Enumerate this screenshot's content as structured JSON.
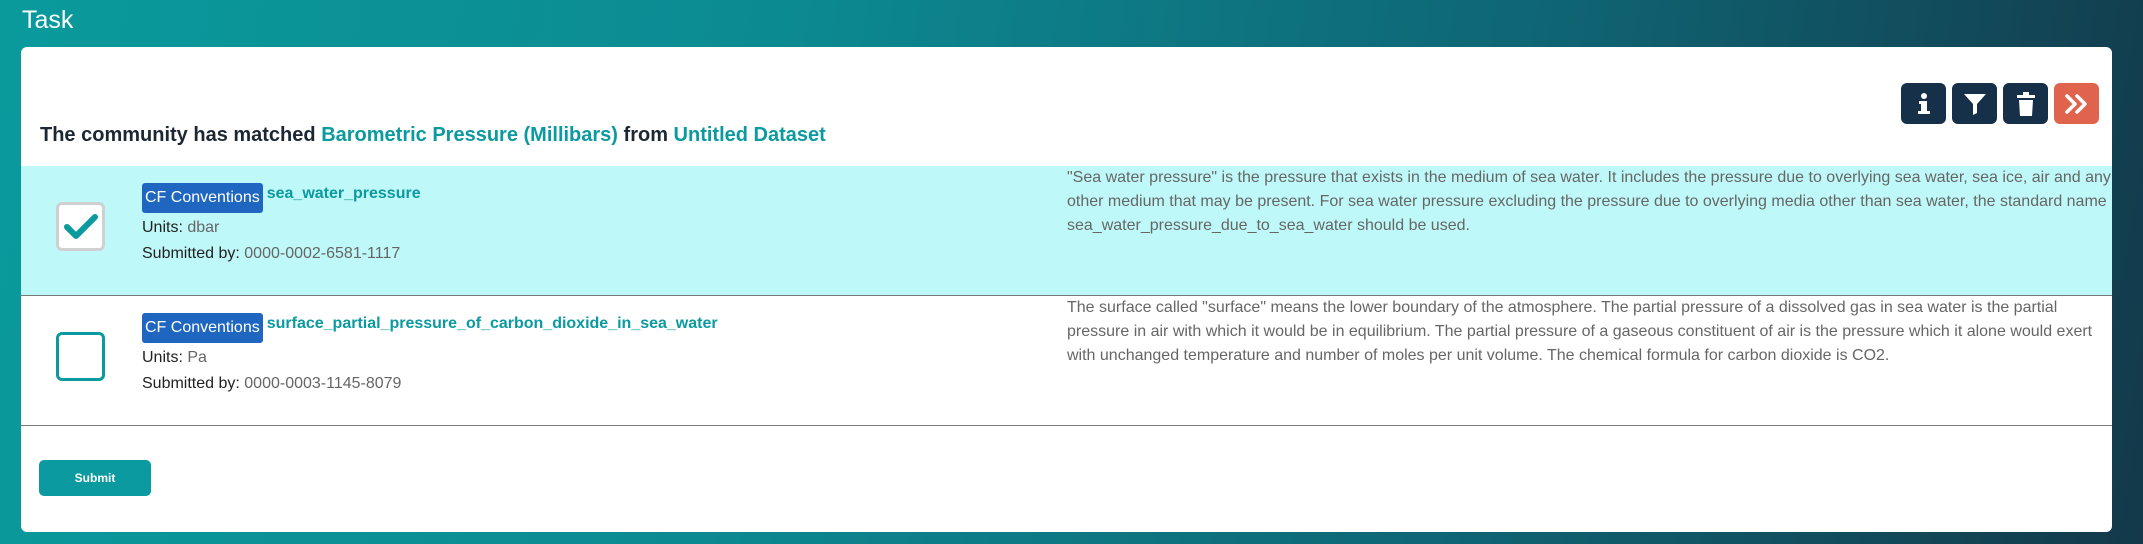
{
  "app": {
    "title": "Task"
  },
  "toolbar": {
    "icons": [
      "info-icon",
      "filter-icon",
      "trash-icon",
      "fast-forward-icon"
    ],
    "next_color": "#e0634e"
  },
  "heading": {
    "prefix": "The community has matched",
    "variable": "Barometric Pressure (Millibars)",
    "connector": "from",
    "dataset": "Untitled Dataset"
  },
  "terms": [
    {
      "selected": true,
      "vocabulary": "CF Conventions",
      "name": "sea_water_pressure",
      "units_label": "Units:",
      "units": "dbar",
      "submitted_label": "Submitted by:",
      "submitted_by": "0000-0002-6581-1117",
      "description": "\"Sea water pressure\" is the pressure that exists in the medium of sea water. It includes the pressure due to overlying sea water, sea ice, air and any other medium that may be present. For sea water pressure excluding the pressure due to overlying media other than sea water, the standard name sea_water_pressure_due_to_sea_water should be used."
    },
    {
      "selected": false,
      "vocabulary": "CF Conventions",
      "name": "surface_partial_pressure_of_carbon_dioxide_in_sea_water",
      "units_label": "Units:",
      "units": "Pa",
      "submitted_label": "Submitted by:",
      "submitted_by": "0000-0003-1145-8079",
      "description": "The surface called \"surface\" means the lower boundary of the atmosphere. The partial pressure of a dissolved gas in sea water is the partial pressure in air with which it would be in equilibrium. The partial pressure of a gaseous constituent of air is the pressure which it alone would exert with unchanged temperature and number of moles per unit volume. The chemical formula for carbon dioxide is CO2."
    }
  ],
  "actions": {
    "submit_label": "Submit"
  },
  "colors": {
    "accent": "#0b9a9f",
    "selected_row": "#bff8f8",
    "badge": "#1f66c1",
    "dark_button": "#16304a"
  }
}
